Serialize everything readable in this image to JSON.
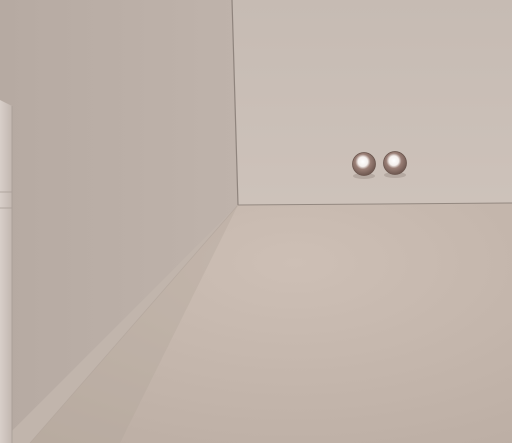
{
  "scene": {
    "description_type": "3d-rendered-room-corner",
    "colors": {
      "left_wall": "#b8aca4",
      "back_wall": "#c8bdb5",
      "floor": "#c4b6ac",
      "edge_line": "#8f847d",
      "sphere_highlight": "#ffffff",
      "sphere_body": "#8a6f66"
    },
    "objects": [
      {
        "name": "glossy-sphere",
        "count": 2
      },
      {
        "name": "box-object",
        "count": 1
      }
    ]
  }
}
